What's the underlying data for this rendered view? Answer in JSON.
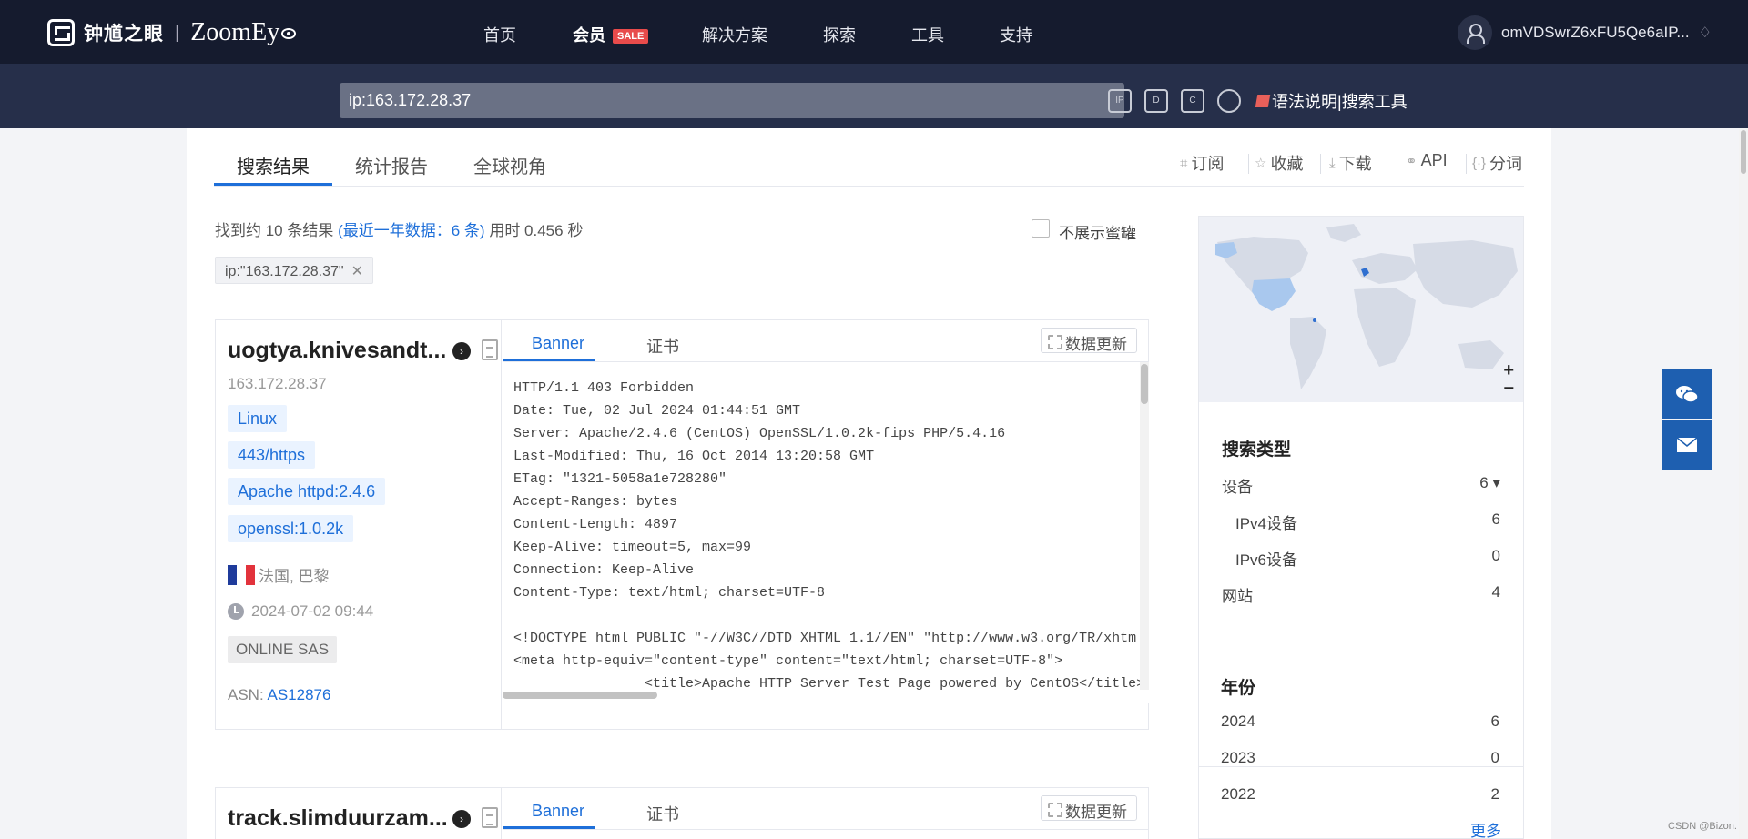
{
  "header": {
    "logo_cn": "钟馗之眼",
    "logo_sep": "|",
    "logo_en": "ZoomEy",
    "nav": [
      {
        "label": "首页"
      },
      {
        "label": "会员",
        "badge": "SALE"
      },
      {
        "label": "解决方案"
      },
      {
        "label": "探索"
      },
      {
        "label": "工具"
      },
      {
        "label": "支持"
      }
    ],
    "username": "omVDSwrZ6xFU5Qe6aIP..."
  },
  "search": {
    "query": "ip:163.172.28.37",
    "icons": [
      "ip-search-icon",
      "domain-search-icon",
      "cert-search-icon",
      "search-icon"
    ],
    "links": [
      "语法说明",
      "|",
      "搜索工具"
    ]
  },
  "tabs": [
    "搜索结果",
    "统计报告",
    "全球视角"
  ],
  "actions": [
    "订阅",
    "收藏",
    "下载",
    "API",
    "分词"
  ],
  "summary": {
    "prefix": "找到约 10 条结果",
    "recent": "(最近一年数据：6 条)",
    "time": "用时 0.456 秒",
    "honeypot_label": "不展示蜜罐"
  },
  "filter_chip": "ip:\"163.172.28.37\"",
  "results": [
    {
      "host": "uogtya.knivesandt...",
      "ip": "163.172.28.37",
      "tags": [
        "Linux",
        "443/https",
        "Apache httpd:2.4.6",
        "openssl:1.0.2k"
      ],
      "location": "法国, 巴黎",
      "time": "2024-07-02 09:44",
      "org": "ONLINE SAS",
      "asn_label": "ASN:",
      "asn": "AS12876",
      "tab_banner": "Banner",
      "tab_cert": "证书",
      "update": "数据更新",
      "banner": "HTTP/1.1 403 Forbidden\nDate: Tue, 02 Jul 2024 01:44:51 GMT\nServer: Apache/2.4.6 (CentOS) OpenSSL/1.0.2k-fips PHP/5.4.16\nLast-Modified: Thu, 16 Oct 2014 13:20:58 GMT\nETag: \"1321-5058a1e728280\"\nAccept-Ranges: bytes\nContent-Length: 4897\nKeep-Alive: timeout=5, max=99\nConnection: Keep-Alive\nContent-Type: text/html; charset=UTF-8\n\n<!DOCTYPE html PUBLIC \"-//W3C//DTD XHTML 1.1//EN\" \"http://www.w3.org/TR/xhtml\n<meta http-equiv=\"content-type\" content=\"text/html; charset=UTF-8\">\n                <title>Apache HTTP Server Test Page powered by CentOS</title>"
    },
    {
      "host": "track.slimduurzam...",
      "tab_banner": "Banner",
      "tab_cert": "证书",
      "update": "数据更新"
    }
  ],
  "sidebar": {
    "map_zoom_in": "+",
    "map_zoom_out": "−",
    "search_type_title": "搜索类型",
    "search_types": [
      {
        "label": "设备",
        "value": "6 ▾"
      },
      {
        "label": "IPv4设备",
        "value": "6"
      },
      {
        "label": "IPv6设备",
        "value": "0"
      },
      {
        "label": "网站",
        "value": "4"
      }
    ],
    "year_title": "年份",
    "years": [
      {
        "label": "2024",
        "value": "6"
      },
      {
        "label": "2023",
        "value": "0"
      },
      {
        "label": "2022",
        "value": "2"
      }
    ],
    "more": "更多"
  },
  "watermark": "CSDN @Bizon.",
  "colors": {
    "nav_bg": "#151b2e",
    "search_bg": "#262f4a",
    "accent": "#1e6fd9",
    "sale": "#e84b4b"
  }
}
